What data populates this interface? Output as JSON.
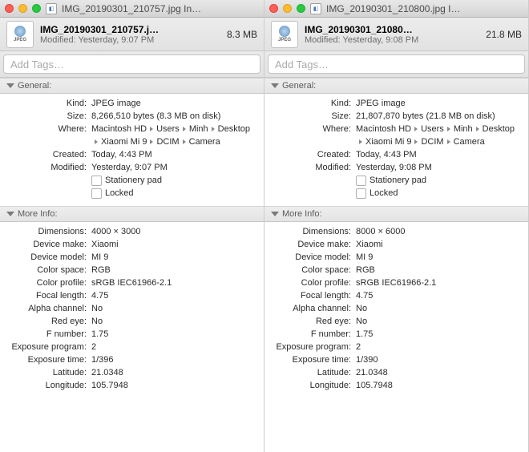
{
  "panel_titles": [
    "IMG_20190301_210757.jpg In…",
    "IMG_20190301_210800.jpg I…"
  ],
  "headers": [
    {
      "name": "IMG_20190301_210757.j…",
      "size": "8.3 MB",
      "modified": "Modified: Yesterday, 9:07 PM"
    },
    {
      "name": "IMG_20190301_21080…",
      "size": "21.8 MB",
      "modified": "Modified: Yesterday, 9:08 PM"
    }
  ],
  "file_icon_label": "JPEG",
  "tags_placeholder": "Add Tags…",
  "section_labels": {
    "general": "General:",
    "more_info": "More Info:"
  },
  "field_labels": {
    "kind": "Kind:",
    "size": "Size:",
    "where": "Where:",
    "created": "Created:",
    "modified": "Modified:",
    "stationery": "Stationery pad",
    "locked": "Locked",
    "dimensions": "Dimensions:",
    "make": "Device make:",
    "model": "Device model:",
    "color_space": "Color space:",
    "color_profile": "Color profile:",
    "focal_length": "Focal length:",
    "alpha": "Alpha channel:",
    "red_eye": "Red eye:",
    "f_number": "F number:",
    "exposure_program": "Exposure program:",
    "exposure_time": "Exposure time:",
    "latitude": "Latitude:",
    "longitude": "Longitude:"
  },
  "path_parts": [
    "Macintosh HD",
    "Users",
    "Minh",
    "Desktop",
    "Xiaomi Mi 9",
    "DCIM",
    "Camera"
  ],
  "general": [
    {
      "kind": "JPEG image",
      "size": "8,266,510 bytes (8.3 MB on disk)",
      "created": "Today, 4:43 PM",
      "modified": "Yesterday, 9:07 PM"
    },
    {
      "kind": "JPEG image",
      "size": "21,807,870 bytes (21.8 MB on disk)",
      "created": "Today, 4:43 PM",
      "modified": "Yesterday, 9:08 PM"
    }
  ],
  "more_info": [
    {
      "dimensions": "4000 × 3000",
      "make": "Xiaomi",
      "model": "MI 9",
      "color_space": "RGB",
      "color_profile": "sRGB IEC61966-2.1",
      "focal_length": "4.75",
      "alpha": "No",
      "red_eye": "No",
      "f_number": "1.75",
      "exposure_program": "2",
      "exposure_time": "1/396",
      "latitude": "21.0348",
      "longitude": "105.7948"
    },
    {
      "dimensions": "8000 × 6000",
      "make": "Xiaomi",
      "model": "MI 9",
      "color_space": "RGB",
      "color_profile": "sRGB IEC61966-2.1",
      "focal_length": "4.75",
      "alpha": "No",
      "red_eye": "No",
      "f_number": "1.75",
      "exposure_program": "2",
      "exposure_time": "1/390",
      "latitude": "21.0348",
      "longitude": "105.7948"
    }
  ]
}
